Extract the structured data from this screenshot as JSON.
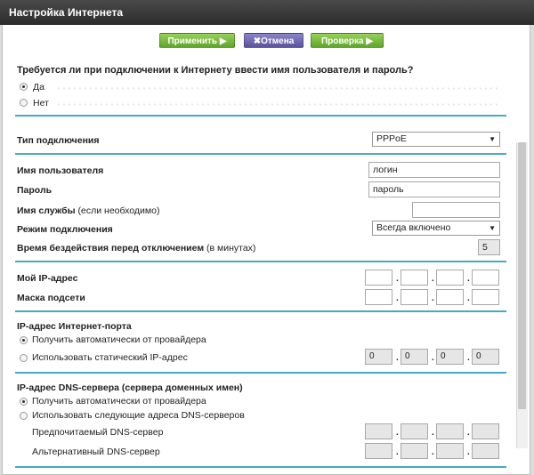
{
  "window": {
    "title": "Настройка Интернета"
  },
  "toolbar": {
    "apply": "Применить ▶",
    "cancel": "✖Отмена",
    "test": "Проверка ▶"
  },
  "login_question": {
    "text": "Требуется ли при подключении к Интернету ввести имя пользователя и пароль?",
    "options": [
      "Да",
      "Нет"
    ],
    "selected": "Да"
  },
  "connection": {
    "type_label": "Тип подключения",
    "type_value": "PPPoE",
    "username_label": "Имя пользователя",
    "username_value": "логин",
    "password_label": "Пароль",
    "password_value": "пароль",
    "service_label": "Имя службы",
    "service_hint": "(если необходимо)",
    "service_value": "",
    "mode_label": "Режим подключения",
    "mode_value": "Всегда включено",
    "idle_label": "Время бездействия перед отключением",
    "idle_hint": "(в минутах)",
    "idle_value": "5"
  },
  "my_ip": {
    "ip_label": "Мой IP-адрес",
    "mask_label": "Маска подсети"
  },
  "internet_port": {
    "title": "IP-адрес Интернет-порта",
    "auto": "Получить автоматически от провайдера",
    "static": "Использовать статический IP-адрес",
    "octets": [
      "0",
      "0",
      "0",
      "0"
    ]
  },
  "dns": {
    "title": "IP-адрес DNS-сервера (сервера доменных имен)",
    "auto": "Получить автоматически от провайдера",
    "manual": "Использовать следующие адреса DNS-серверов",
    "primary": "Предпочитаемый DNS-сервер",
    "secondary": "Альтернативный DNS-сервер"
  },
  "colors": {
    "accent": "#46a9c8",
    "button_green": "#6fb536",
    "button_purple": "#6a63ab"
  }
}
